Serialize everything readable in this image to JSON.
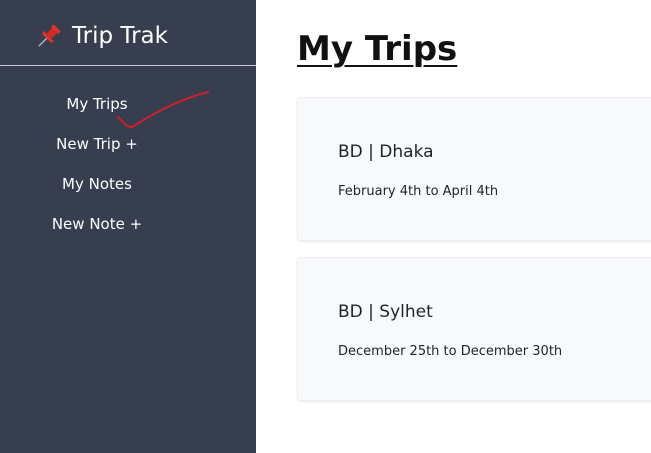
{
  "sidebar": {
    "brand": {
      "icon": "pushpin-icon",
      "name": "Trip Trak"
    },
    "items": [
      {
        "label": "My Trips",
        "name": "sidebar-item-my-trips"
      },
      {
        "label": "New Trip +",
        "name": "sidebar-item-new-trip"
      },
      {
        "label": "My Notes",
        "name": "sidebar-item-my-notes"
      },
      {
        "label": "New Note +",
        "name": "sidebar-item-new-note"
      }
    ]
  },
  "main": {
    "title": "My Trips",
    "trips": [
      {
        "name": "BD | Dhaka",
        "dates": "February 4th to April 4th"
      },
      {
        "name": "BD | Sylhet",
        "dates": "December 25th to December 30th"
      }
    ]
  },
  "colors": {
    "sidebar_bg": "#373e4f",
    "card_bg": "#f8f9fa",
    "annotation_red": "#d0202a"
  }
}
